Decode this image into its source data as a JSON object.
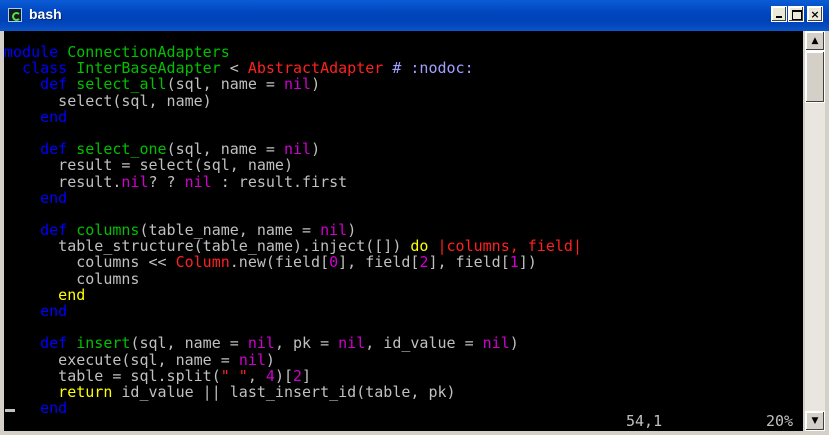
{
  "window": {
    "title": "bash",
    "minimize_label": "",
    "maximize_label": "",
    "close_label": "×"
  },
  "editor": {
    "lines": [
      [
        {
          "t": "module ",
          "c": "c-kw"
        },
        {
          "t": "ConnectionAdapters",
          "c": "c-name"
        }
      ],
      [
        {
          "t": "  class ",
          "c": "c-kw"
        },
        {
          "t": "InterBaseAdapter",
          "c": "c-name"
        },
        {
          "t": " < ",
          "c": "c-text"
        },
        {
          "t": "AbstractAdapter",
          "c": "c-const"
        },
        {
          "t": " # :nodoc:",
          "c": "c-comment"
        }
      ],
      [
        {
          "t": "    def ",
          "c": "c-kw"
        },
        {
          "t": "select_all",
          "c": "c-name"
        },
        {
          "t": "(sql, name = ",
          "c": "c-text"
        },
        {
          "t": "nil",
          "c": "c-nil"
        },
        {
          "t": ")",
          "c": "c-text"
        }
      ],
      [
        {
          "t": "      select(sql, name)",
          "c": "c-text"
        }
      ],
      [
        {
          "t": "    end",
          "c": "c-kw"
        }
      ],
      [],
      [
        {
          "t": "    def ",
          "c": "c-kw"
        },
        {
          "t": "select_one",
          "c": "c-name"
        },
        {
          "t": "(sql, name = ",
          "c": "c-text"
        },
        {
          "t": "nil",
          "c": "c-nil"
        },
        {
          "t": ")",
          "c": "c-text"
        }
      ],
      [
        {
          "t": "      result = select(sql, name)",
          "c": "c-text"
        }
      ],
      [
        {
          "t": "      result.",
          "c": "c-text"
        },
        {
          "t": "nil",
          "c": "c-nil"
        },
        {
          "t": "? ? ",
          "c": "c-text"
        },
        {
          "t": "nil",
          "c": "c-nil"
        },
        {
          "t": " : result.first",
          "c": "c-text"
        }
      ],
      [
        {
          "t": "    end",
          "c": "c-kw"
        }
      ],
      [],
      [
        {
          "t": "    def ",
          "c": "c-kw"
        },
        {
          "t": "columns",
          "c": "c-name"
        },
        {
          "t": "(table_name, name = ",
          "c": "c-text"
        },
        {
          "t": "nil",
          "c": "c-nil"
        },
        {
          "t": ")",
          "c": "c-text"
        }
      ],
      [
        {
          "t": "      table_structure(table_name).inject([]) ",
          "c": "c-text"
        },
        {
          "t": "do",
          "c": "c-ret"
        },
        {
          "t": " |columns, field|",
          "c": "c-const"
        }
      ],
      [
        {
          "t": "        columns << ",
          "c": "c-text"
        },
        {
          "t": "Column",
          "c": "c-const"
        },
        {
          "t": ".new(field[",
          "c": "c-text"
        },
        {
          "t": "0",
          "c": "c-nil"
        },
        {
          "t": "], field[",
          "c": "c-text"
        },
        {
          "t": "2",
          "c": "c-nil"
        },
        {
          "t": "], field[",
          "c": "c-text"
        },
        {
          "t": "1",
          "c": "c-nil"
        },
        {
          "t": "])",
          "c": "c-text"
        }
      ],
      [
        {
          "t": "        columns",
          "c": "c-text"
        }
      ],
      [
        {
          "t": "      end",
          "c": "c-ret"
        }
      ],
      [
        {
          "t": "    end",
          "c": "c-kw"
        }
      ],
      [],
      [
        {
          "t": "    def ",
          "c": "c-kw"
        },
        {
          "t": "insert",
          "c": "c-name"
        },
        {
          "t": "(sql, name = ",
          "c": "c-text"
        },
        {
          "t": "nil",
          "c": "c-nil"
        },
        {
          "t": ", pk = ",
          "c": "c-text"
        },
        {
          "t": "nil",
          "c": "c-nil"
        },
        {
          "t": ", id_value = ",
          "c": "c-text"
        },
        {
          "t": "nil",
          "c": "c-nil"
        },
        {
          "t": ")",
          "c": "c-text"
        }
      ],
      [
        {
          "t": "      execute(sql, name = ",
          "c": "c-text"
        },
        {
          "t": "nil",
          "c": "c-nil"
        },
        {
          "t": ")",
          "c": "c-text"
        }
      ],
      [
        {
          "t": "      table = sql.split(",
          "c": "c-text"
        },
        {
          "t": "\" \"",
          "c": "c-const"
        },
        {
          "t": ", ",
          "c": "c-text"
        },
        {
          "t": "4",
          "c": "c-nil"
        },
        {
          "t": ")[",
          "c": "c-text"
        },
        {
          "t": "2",
          "c": "c-nil"
        },
        {
          "t": "]",
          "c": "c-text"
        }
      ],
      [
        {
          "t": "      return",
          "c": "c-ret"
        },
        {
          "t": " id_value || last_insert_id(table, pk)",
          "c": "c-text"
        }
      ],
      [
        {
          "t": "    end",
          "c": "c-kw"
        }
      ]
    ]
  },
  "status": {
    "position": "54,1",
    "percent": "20%"
  },
  "scrollbar": {
    "up_arrow": "▲",
    "down_arrow": "▼"
  }
}
